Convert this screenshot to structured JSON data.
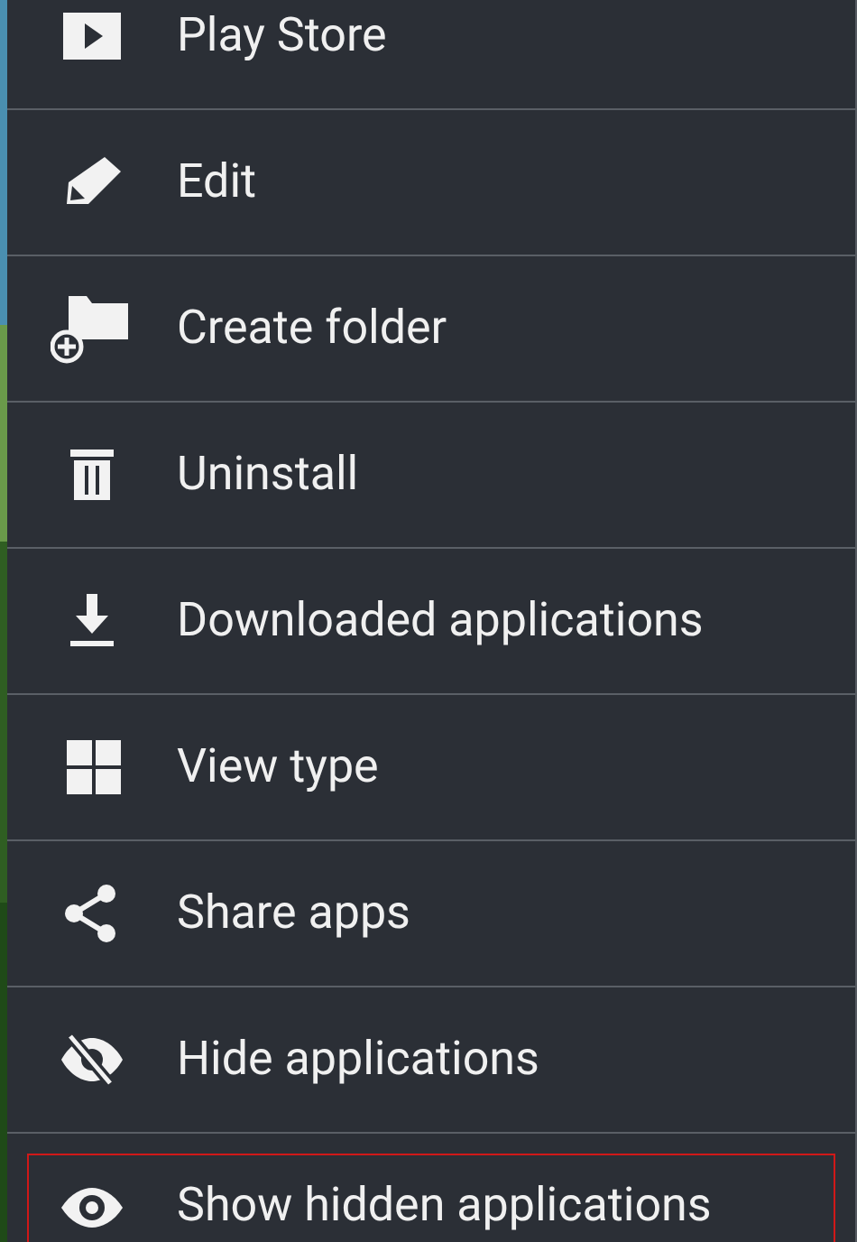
{
  "menu": {
    "items": [
      {
        "label": "Play Store",
        "highlighted": false
      },
      {
        "label": "Edit",
        "highlighted": false
      },
      {
        "label": "Create folder",
        "highlighted": false
      },
      {
        "label": "Uninstall",
        "highlighted": false
      },
      {
        "label": "Downloaded applications",
        "highlighted": false
      },
      {
        "label": "View type",
        "highlighted": false
      },
      {
        "label": "Share apps",
        "highlighted": false
      },
      {
        "label": "Hide applications",
        "highlighted": false
      },
      {
        "label": "Show hidden applications",
        "highlighted": true
      }
    ]
  }
}
